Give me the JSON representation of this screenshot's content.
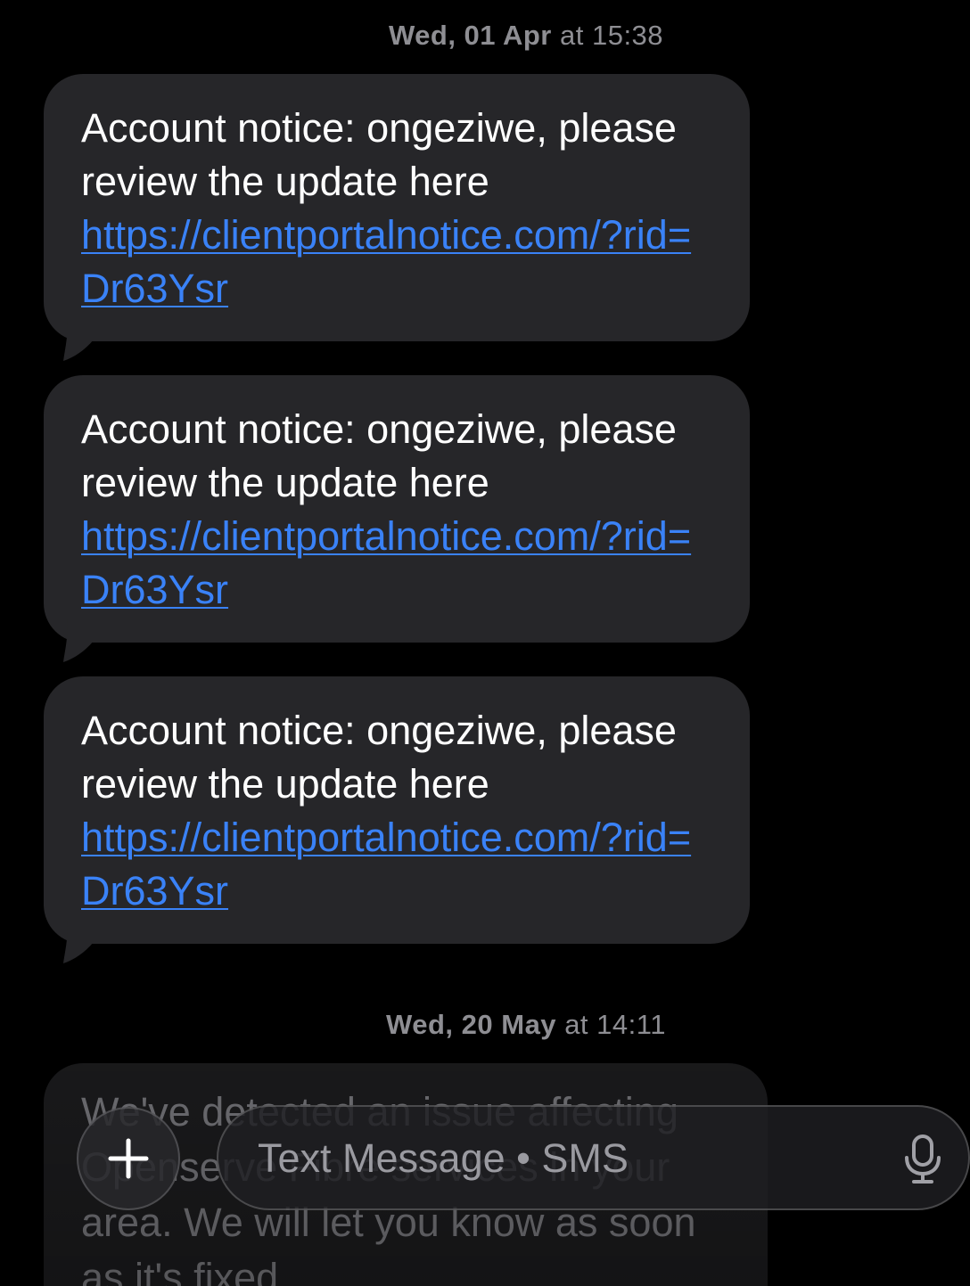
{
  "conversation": {
    "timestamps": [
      {
        "date": "Wed, 01 Apr",
        "time": "at 15:38"
      },
      {
        "date": "Wed, 20 May",
        "time": "at 14:11"
      }
    ],
    "messages": [
      {
        "text": "Account notice: ongeziwe, please review the update here",
        "link": "https://clientportalnotice.com/?rid=Dr63Ysr"
      },
      {
        "text": "Account notice: ongeziwe, please review the update here",
        "link": "https://clientportalnotice.com/?rid=Dr63Ysr"
      },
      {
        "text": "Account notice: ongeziwe, please review the update here",
        "link": "https://clientportalnotice.com/?rid=Dr63Ysr"
      }
    ],
    "partial_message": {
      "text": "We've detected an issue affecting Openserve Fibre services in your area. We will let you know as soon as it's fixed"
    }
  },
  "composer": {
    "placeholder": "Text Message • SMS",
    "plus_icon": "plus-icon",
    "mic_icon": "microphone-icon"
  },
  "colors": {
    "background": "#000000",
    "bubble": "#262629",
    "link": "#3a82f7",
    "timestamp": "#8e8e93"
  }
}
